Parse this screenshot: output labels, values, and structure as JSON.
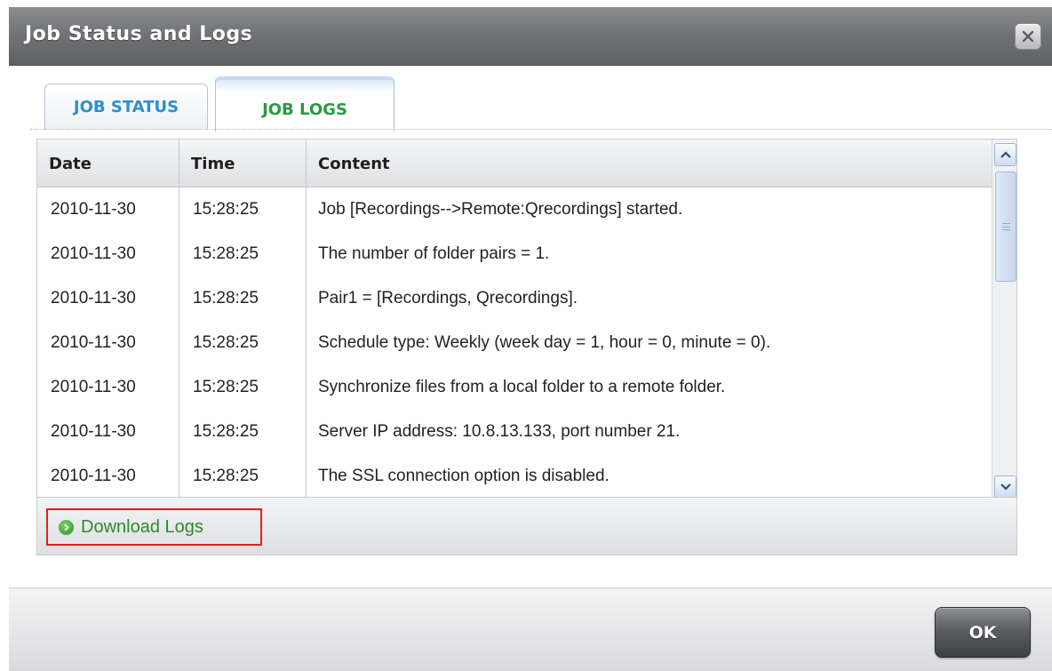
{
  "dialog": {
    "title": "Job Status and Logs",
    "close_icon": "close-x-icon"
  },
  "tabs": [
    {
      "label": "JOB STATUS",
      "selected": false
    },
    {
      "label": "JOB LOGS",
      "selected": true
    }
  ],
  "grid": {
    "columns": [
      "Date",
      "Time",
      "Content"
    ],
    "rows": [
      {
        "date": "2010-11-30",
        "time": "15:28:25",
        "content": "Job [Recordings-->Remote:Qrecordings] started."
      },
      {
        "date": "2010-11-30",
        "time": "15:28:25",
        "content": "The number of folder pairs = 1."
      },
      {
        "date": "2010-11-30",
        "time": "15:28:25",
        "content": "Pair1 = [Recordings, Qrecordings]."
      },
      {
        "date": "2010-11-30",
        "time": "15:28:25",
        "content": "Schedule type: Weekly (week day = 1, hour = 0, minute = 0)."
      },
      {
        "date": "2010-11-30",
        "time": "15:28:25",
        "content": "Synchronize files from a local folder to a remote folder."
      },
      {
        "date": "2010-11-30",
        "time": "15:28:25",
        "content": "Server IP address: 10.8.13.133, port number 21."
      },
      {
        "date": "2010-11-30",
        "time": "15:28:25",
        "content": "The SSL connection option is disabled."
      }
    ]
  },
  "footer": {
    "download_label": "Download Logs",
    "download_icon": "green-arrow-icon"
  },
  "buttons": {
    "ok_label": "OK"
  },
  "colors": {
    "title_bar": "#6f7174",
    "tab_inactive_text": "#2b8fd1",
    "tab_active_text": "#2a9a3e",
    "download_link": "#2c8a2c",
    "highlight_border": "#e02020"
  }
}
